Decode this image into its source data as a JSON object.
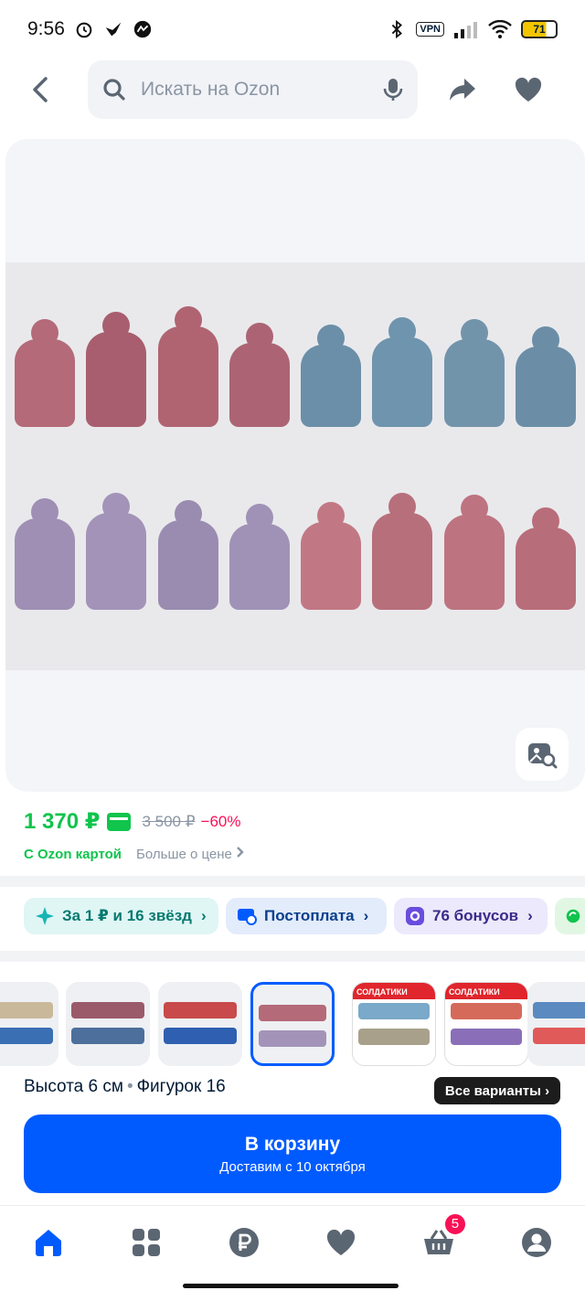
{
  "status_bar": {
    "time": "9:56",
    "vpn": "VPN",
    "battery": "71"
  },
  "header": {
    "search_placeholder": "Искать на Ozon"
  },
  "product": {
    "price": "1 370 ₽",
    "old_price": "3 500 ₽",
    "discount": "−60%",
    "ozon_card_label": "С Ozon картой",
    "more_price_label": "Больше о цене"
  },
  "chips": [
    {
      "label": "За 1 ₽ и 16 звёзд",
      "arrow": "›"
    },
    {
      "label": "Постоплата",
      "arrow": "›"
    },
    {
      "label": "76 бонусов",
      "arrow": "›"
    }
  ],
  "variants": {
    "thumb_label_a": "СОЛДАТИКИ",
    "thumb_label_b": "СОЛДАТИКИ",
    "attributes": {
      "height": "Высота 6 см",
      "sep": "•",
      "count": "Фигурок 16"
    },
    "all_variants_label": "Все варианты ›"
  },
  "cart_button": {
    "label": "В корзину",
    "delivery": "Доставим с 10 октября"
  },
  "nav": {
    "cart_badge": "5"
  },
  "colors": {
    "accent": "#005bff",
    "price_green": "#10c44c",
    "discount_pink": "#f91155"
  }
}
